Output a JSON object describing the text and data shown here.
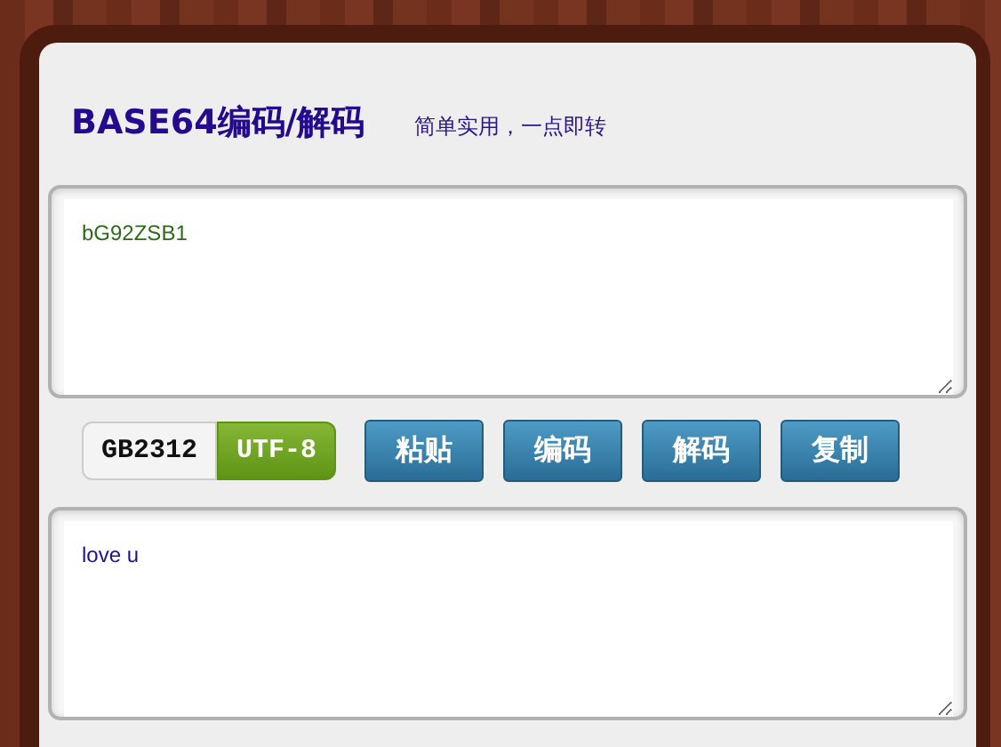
{
  "header": {
    "title": "BASE64编码/解码",
    "subtitle": "简单实用，一点即转"
  },
  "input": {
    "value": "bG92ZSB1"
  },
  "encodings": [
    {
      "label": "GB2312",
      "selected": false
    },
    {
      "label": "UTF-8",
      "selected": true
    }
  ],
  "buttons": [
    "粘贴",
    "编码",
    "解码",
    "复制"
  ],
  "output": {
    "value": "love u"
  }
}
